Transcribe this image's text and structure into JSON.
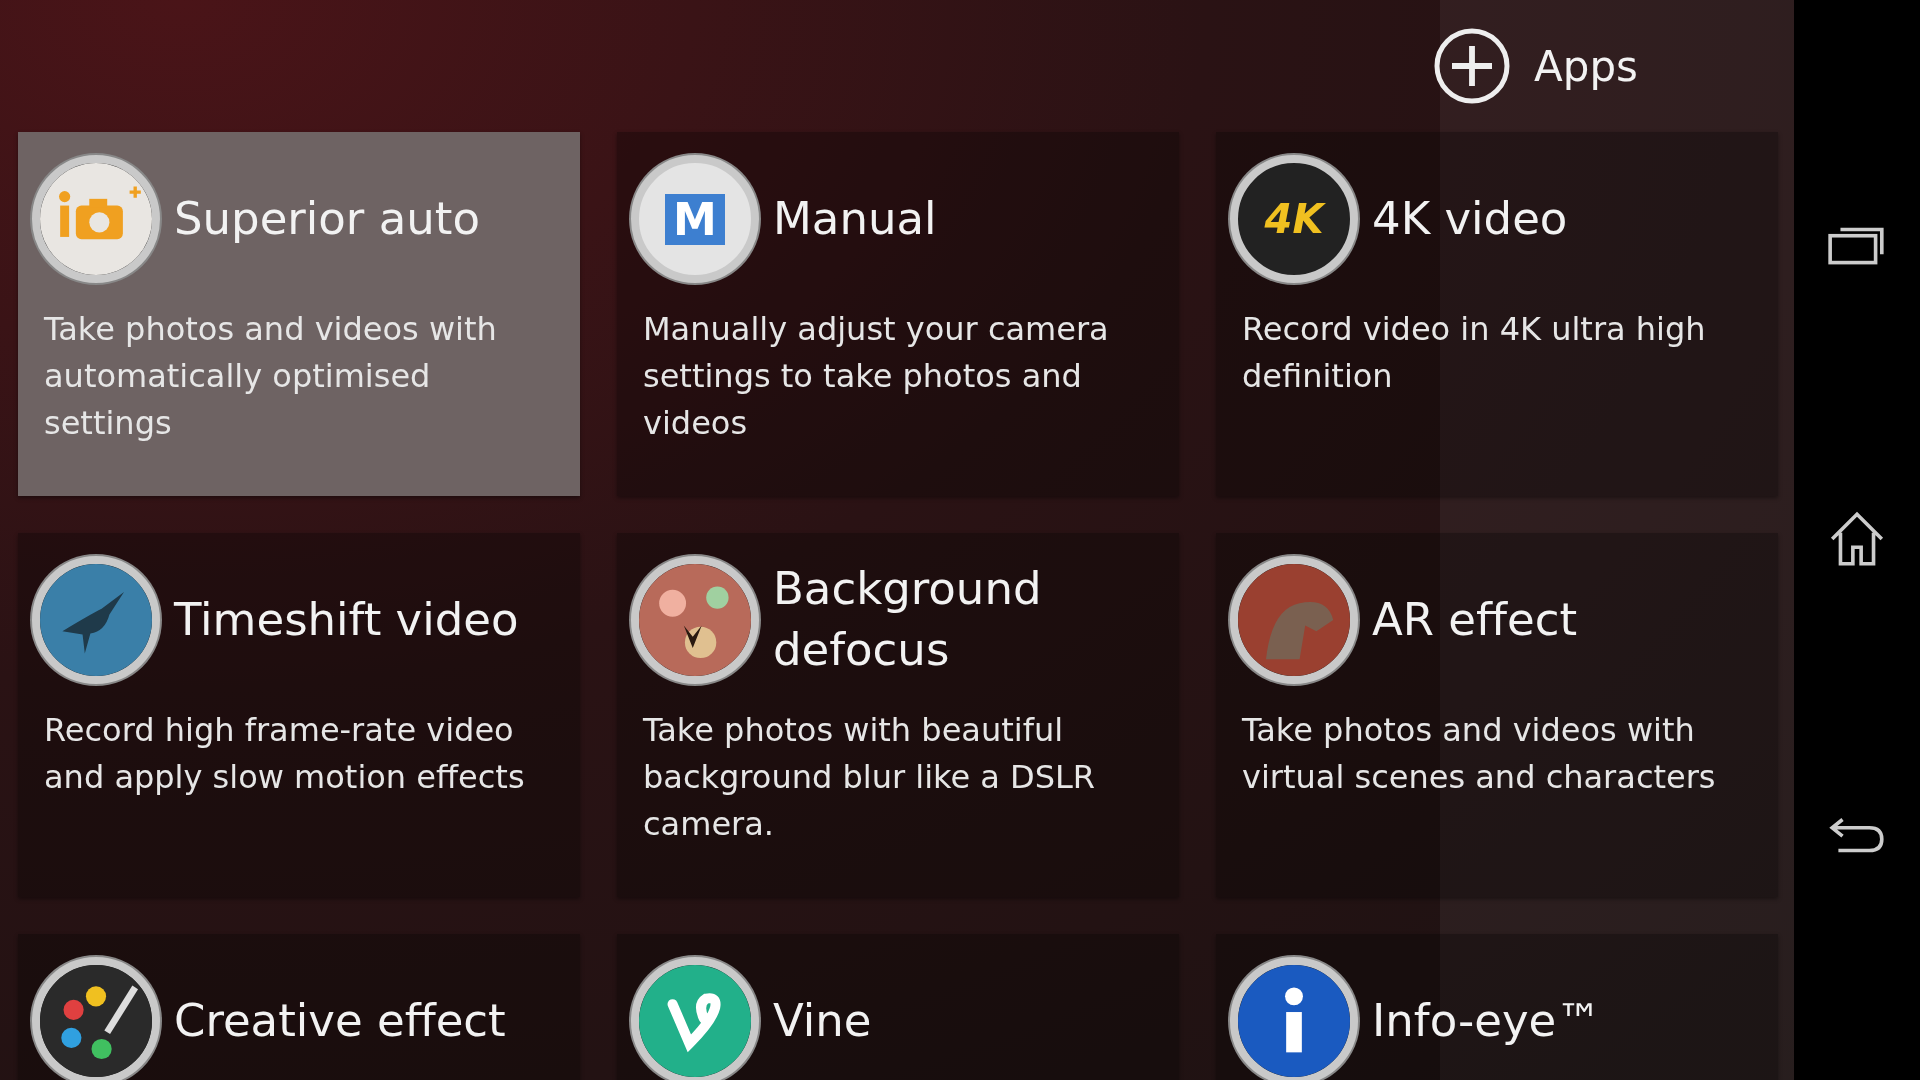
{
  "apps_button": {
    "label": "Apps"
  },
  "modes": [
    {
      "title": "Superior auto",
      "description": "Take photos and videos with automatically optimised settings",
      "selected": true
    },
    {
      "title": "Manual",
      "description": "Manually adjust your camera settings to take photos and videos",
      "selected": false,
      "icon_text": "M"
    },
    {
      "title": "4K video",
      "description": "Record video in 4K ultra high definition",
      "selected": false,
      "icon_text": "4K"
    },
    {
      "title": "Timeshift video",
      "description": "Record high frame-rate video and apply slow motion effects",
      "selected": false
    },
    {
      "title": "Background defocus",
      "description": "Take photos with beautiful background blur like a DSLR camera.",
      "selected": false
    },
    {
      "title": "AR effect",
      "description": "Take photos and videos with virtual scenes and characters",
      "selected": false
    },
    {
      "title": "Creative effect",
      "selected": false
    },
    {
      "title": "Vine",
      "selected": false
    },
    {
      "title": "Info-eye™",
      "selected": false
    }
  ]
}
